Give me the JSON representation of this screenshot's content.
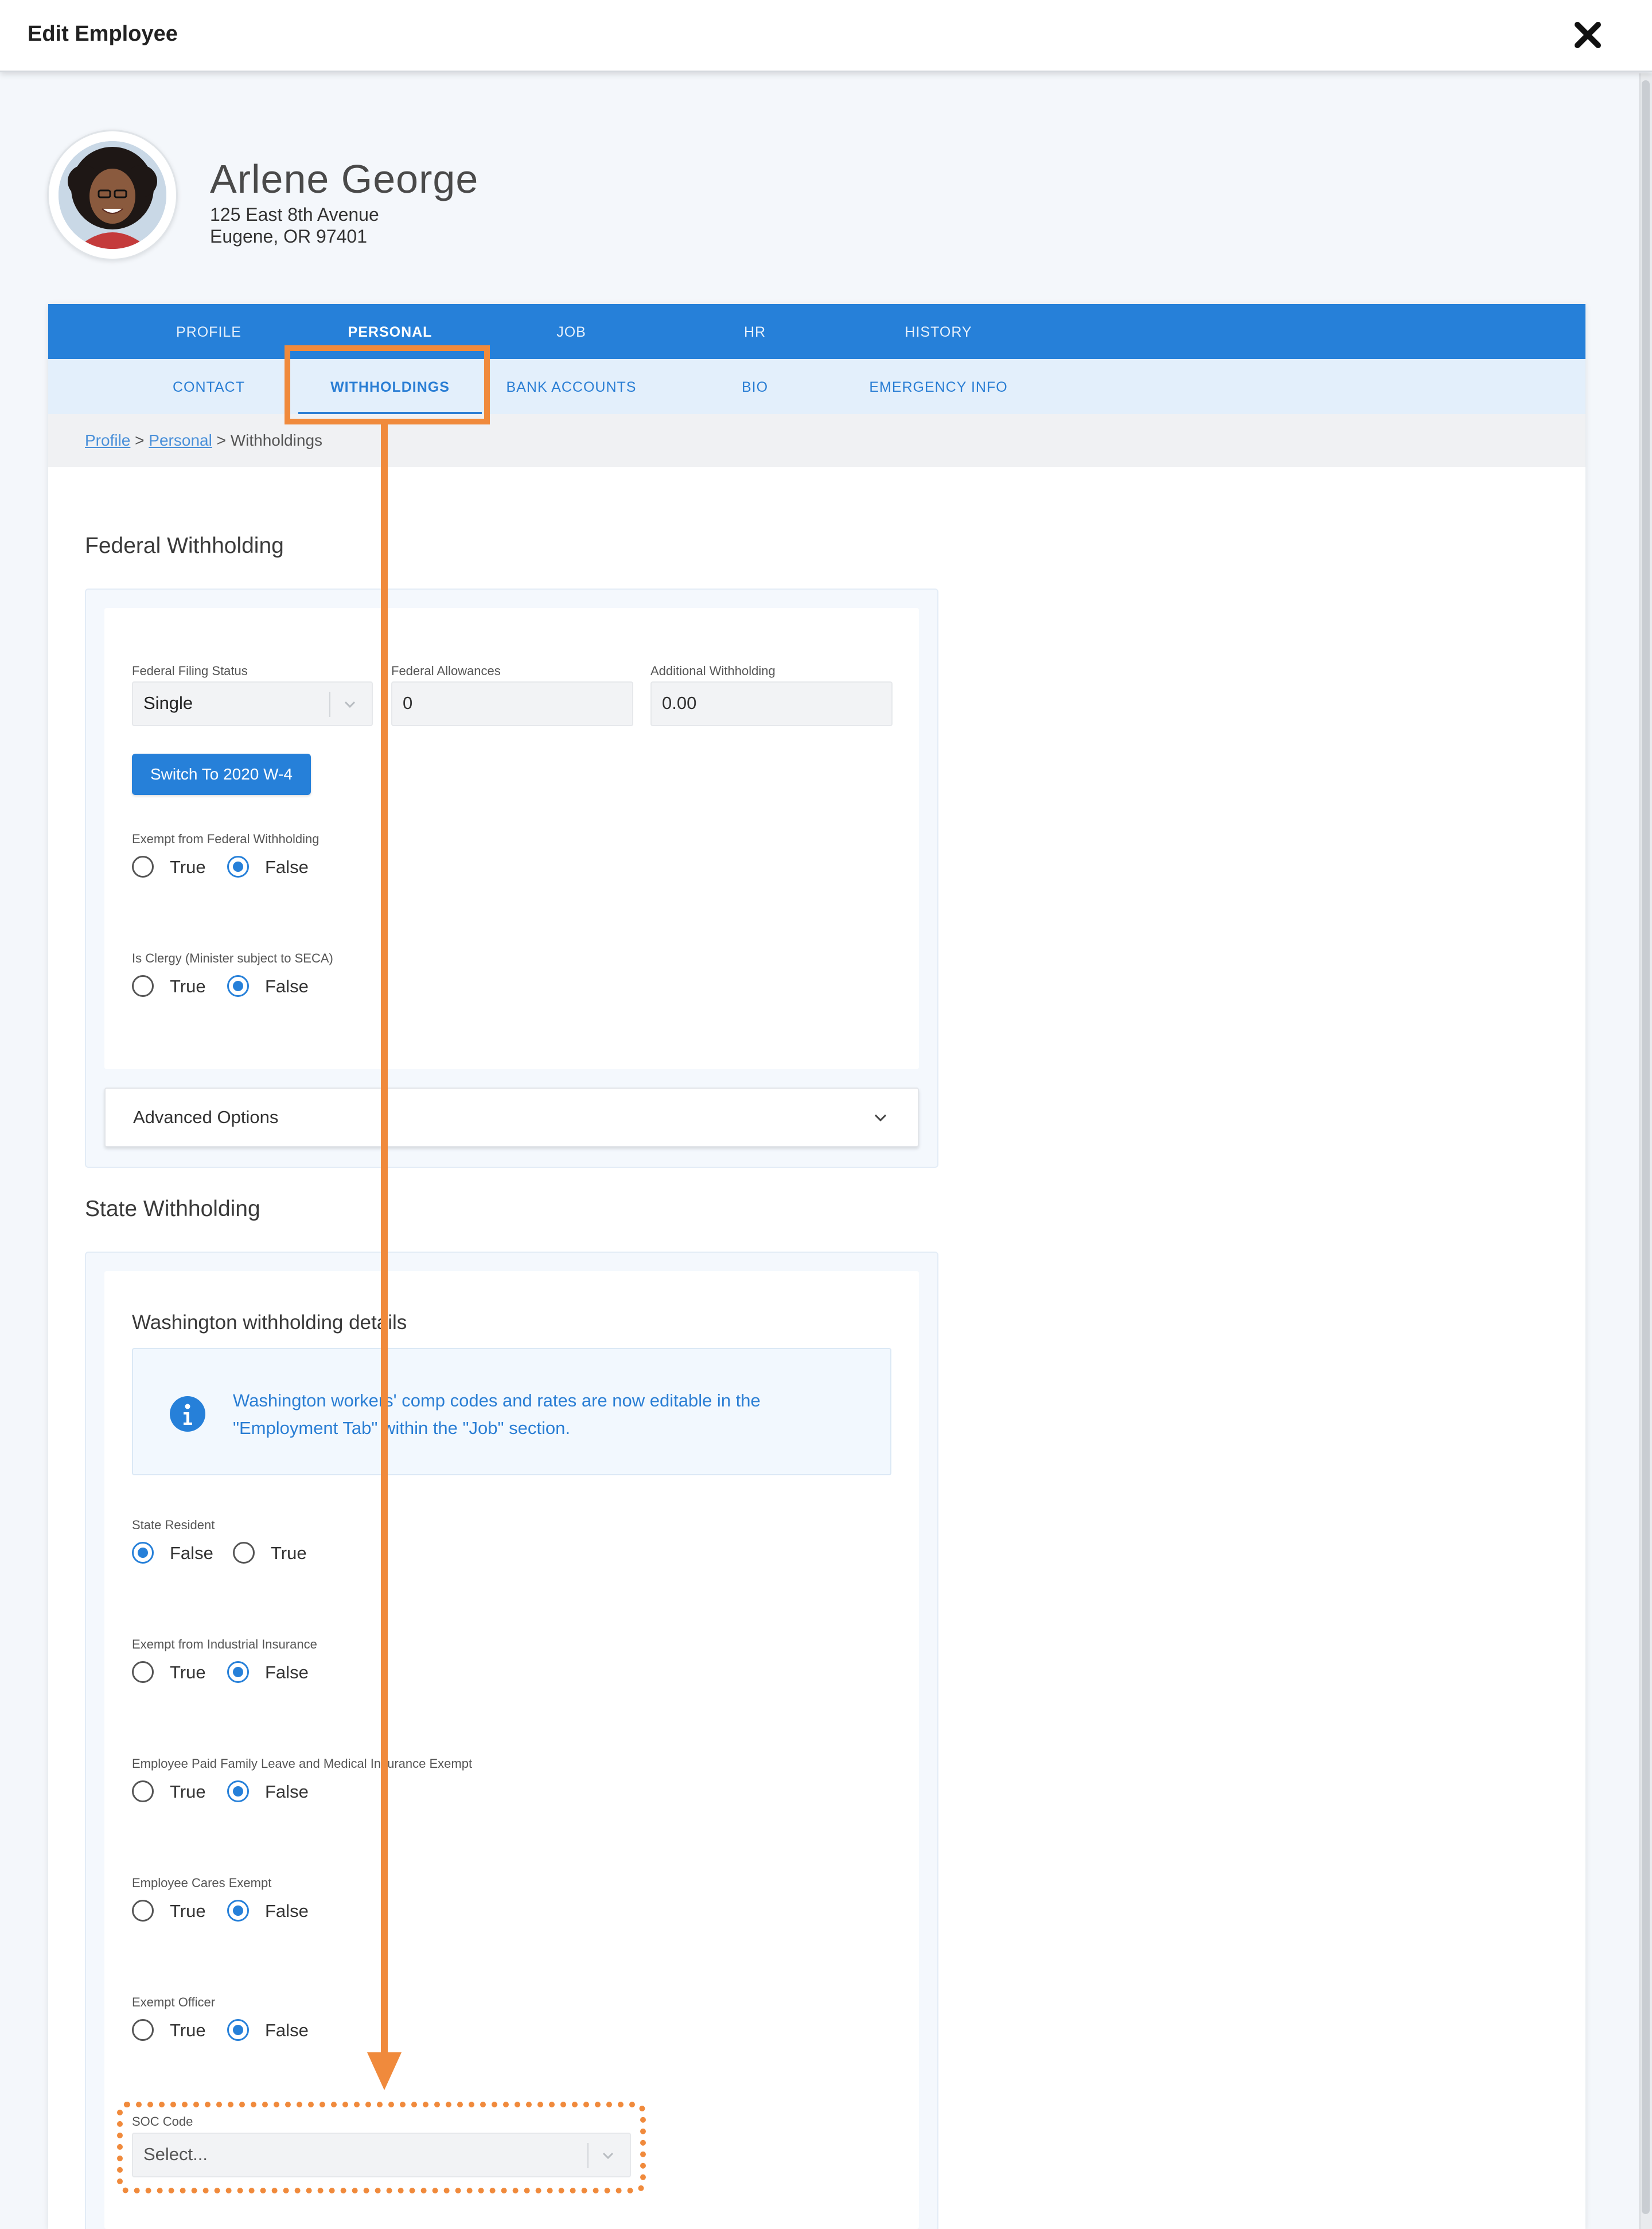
{
  "window": {
    "title": "Edit Employee",
    "close_icon": "close-icon"
  },
  "employee": {
    "name": "Arlene George",
    "address_line1": "125 East 8th Avenue",
    "address_line2": "Eugene, OR 97401"
  },
  "primary_tabs": [
    "PROFILE",
    "PERSONAL",
    "JOB",
    "HR",
    "HISTORY"
  ],
  "primary_active": "PERSONAL",
  "secondary_tabs": [
    "CONTACT",
    "WITHHOLDINGS",
    "BANK ACCOUNTS",
    "BIO",
    "EMERGENCY INFO"
  ],
  "secondary_active": "WITHHOLDINGS",
  "breadcrumb": {
    "link1": "Profile",
    "sep1": " > ",
    "link2": "Personal",
    "sep2": " > ",
    "current": "Withholdings"
  },
  "federal": {
    "section_title": "Federal Withholding",
    "filing_status_label": "Federal Filing Status",
    "filing_status_value": "Single",
    "allowances_label": "Federal Allowances",
    "allowances_value": "0",
    "additional_label": "Additional Withholding",
    "additional_value": "0.00",
    "switch_button": "Switch To 2020 W-4",
    "exempt_label": "Exempt from Federal Withholding",
    "exempt_true": "True",
    "exempt_false": "False",
    "exempt_selected": "False",
    "clergy_label": "Is Clergy (Minister subject to SECA)",
    "clergy_true": "True",
    "clergy_false": "False",
    "clergy_selected": "False",
    "advanced_label": "Advanced Options"
  },
  "state": {
    "section_title": "State Withholding",
    "subtitle": "Washington withholding details",
    "info_line1": "Washington workers' comp codes and rates are now editable in the",
    "info_line2": "\"Employment Tab\" within the \"Job\" section.",
    "resident_label": "State Resident",
    "resident_opt1": "False",
    "resident_opt2": "True",
    "resident_selected": "False",
    "industrial_label": "Exempt from Industrial Insurance",
    "industrial_true": "True",
    "industrial_false": "False",
    "pfml_label": "Employee Paid Family Leave and Medical Insurance Exempt",
    "pfml_true": "True",
    "pfml_false": "False",
    "cares_label": "Employee Cares Exempt",
    "cares_true": "True",
    "cares_false": "False",
    "officer_label": "Exempt Officer",
    "officer_true": "True",
    "officer_false": "False",
    "soc_label": "SOC Code",
    "soc_placeholder": "Select..."
  },
  "colors": {
    "brand_blue": "#2680d9",
    "annotation_orange": "#f08a3c"
  }
}
